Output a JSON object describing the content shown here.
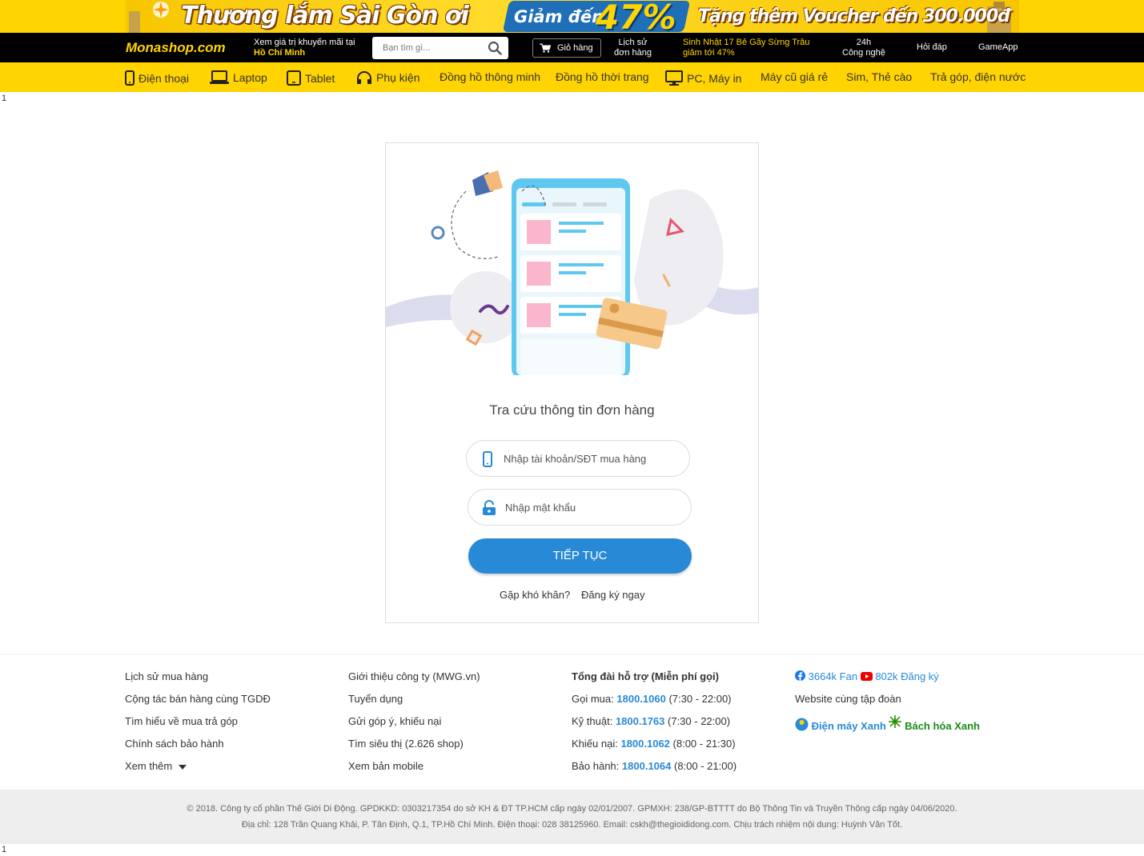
{
  "promo": {
    "headline": "Thương lắm Sài Gòn ơi",
    "discount_prefix": "Giảm đến",
    "discount_value": "47%",
    "voucher": "Tặng thêm Voucher đến 300.000đ"
  },
  "header": {
    "logo": "Monashop.com",
    "location_line1": "Xem giá trị khuyến mãi tại",
    "location_city": "Hồ Chí Minh",
    "search_placeholder": "Bạn tìm gì...",
    "cart_label": "Giỏ hàng",
    "order_history_l1": "Lịch sử",
    "order_history_l2": "đơn hàng",
    "promo_l1": "Sinh Nhật 17 Bẻ Gãy Sừng Trâu",
    "promo_l2": "giảm tới 47%",
    "news_l1": "24h",
    "news_l2": "Công nghệ",
    "faq": "Hỏi đáp",
    "gameapp": "GameApp"
  },
  "categories": [
    {
      "label": "Điện thoại",
      "icon": "phone-icon"
    },
    {
      "label": "Laptop",
      "icon": "laptop-icon"
    },
    {
      "label": "Tablet",
      "icon": "tablet-icon"
    },
    {
      "label": "Phụ kiện",
      "icon": "headphones-icon"
    },
    {
      "label": "Đồng hồ thông minh",
      "icon": ""
    },
    {
      "label": "Đồng hồ thời trang",
      "icon": ""
    },
    {
      "label": "PC, Máy in",
      "icon": "monitor-icon"
    },
    {
      "label": "Máy cũ giá rẻ",
      "icon": ""
    },
    {
      "label": "Sim, Thẻ cào",
      "icon": ""
    },
    {
      "label": "Trả góp, điện nước",
      "icon": ""
    }
  ],
  "stray_top": "1",
  "stray_bottom": "1",
  "lookup": {
    "title": "Tra cứu thông tin đơn hàng",
    "account_placeholder": "Nhập tài khoản/SĐT mua hàng",
    "password_placeholder": "Nhập mật khẩu",
    "submit": "TIẾP TỤC",
    "help": "Gặp khó khăn?",
    "register": "Đăng ký ngay"
  },
  "footer": {
    "col1": [
      "Lịch sử mua hàng",
      "Cộng tác bán hàng cùng TGDĐ",
      "Tìm hiểu về mua trả góp",
      "Chính sách bảo hành",
      "Xem thêm"
    ],
    "col2": [
      "Giới thiệu công ty (MWG.vn)",
      "Tuyển dụng",
      "Gửi góp ý, khiếu nại",
      "Tìm siêu thị (2.626 shop)",
      "Xem bản mobile"
    ],
    "hotline_title": "Tổng đài hỗ trợ (Miễn phí gọi)",
    "hotlines": [
      {
        "label": "Gọi mua:",
        "number": "1800.1060",
        "hours": "(7:30 - 22:00)"
      },
      {
        "label": "Kỹ thuật:",
        "number": "1800.1763",
        "hours": "(7:30 - 22:00)"
      },
      {
        "label": "Khiếu nại:",
        "number": "1800.1062",
        "hours": "(8:00 - 21:30)"
      },
      {
        "label": "Bảo hành:",
        "number": "1800.1064",
        "hours": "(8:00 - 21:00)"
      }
    ],
    "facebook": "3664k Fan",
    "youtube": "802k Đăng ký",
    "group_title": "Website cùng tập đoàn",
    "site1": "Điện máy Xanh",
    "site2": "Bách hóa Xanh"
  },
  "copyright": {
    "line1": "© 2018. Công ty cổ phần Thế Giới Di Động. GPDKKD: 0303217354 do sở KH & ĐT TP.HCM cấp ngày 02/01/2007. GPMXH: 238/GP-BTTTT do Bộ Thông Tin và Truyền Thông cấp ngày 04/06/2020.",
    "line2": "Địa chỉ: 128 Trần Quang Khải, P. Tân Định, Q.1, TP.Hồ Chí Minh. Điện thoại: 028 38125960. Email: cskh@thegioididong.com. Chịu trách nhiệm nội dung: Huỳnh Văn Tốt."
  },
  "colors": {
    "brand_yellow": "#ffd400",
    "brand_blue": "#288ad6",
    "header_black": "#000000"
  }
}
